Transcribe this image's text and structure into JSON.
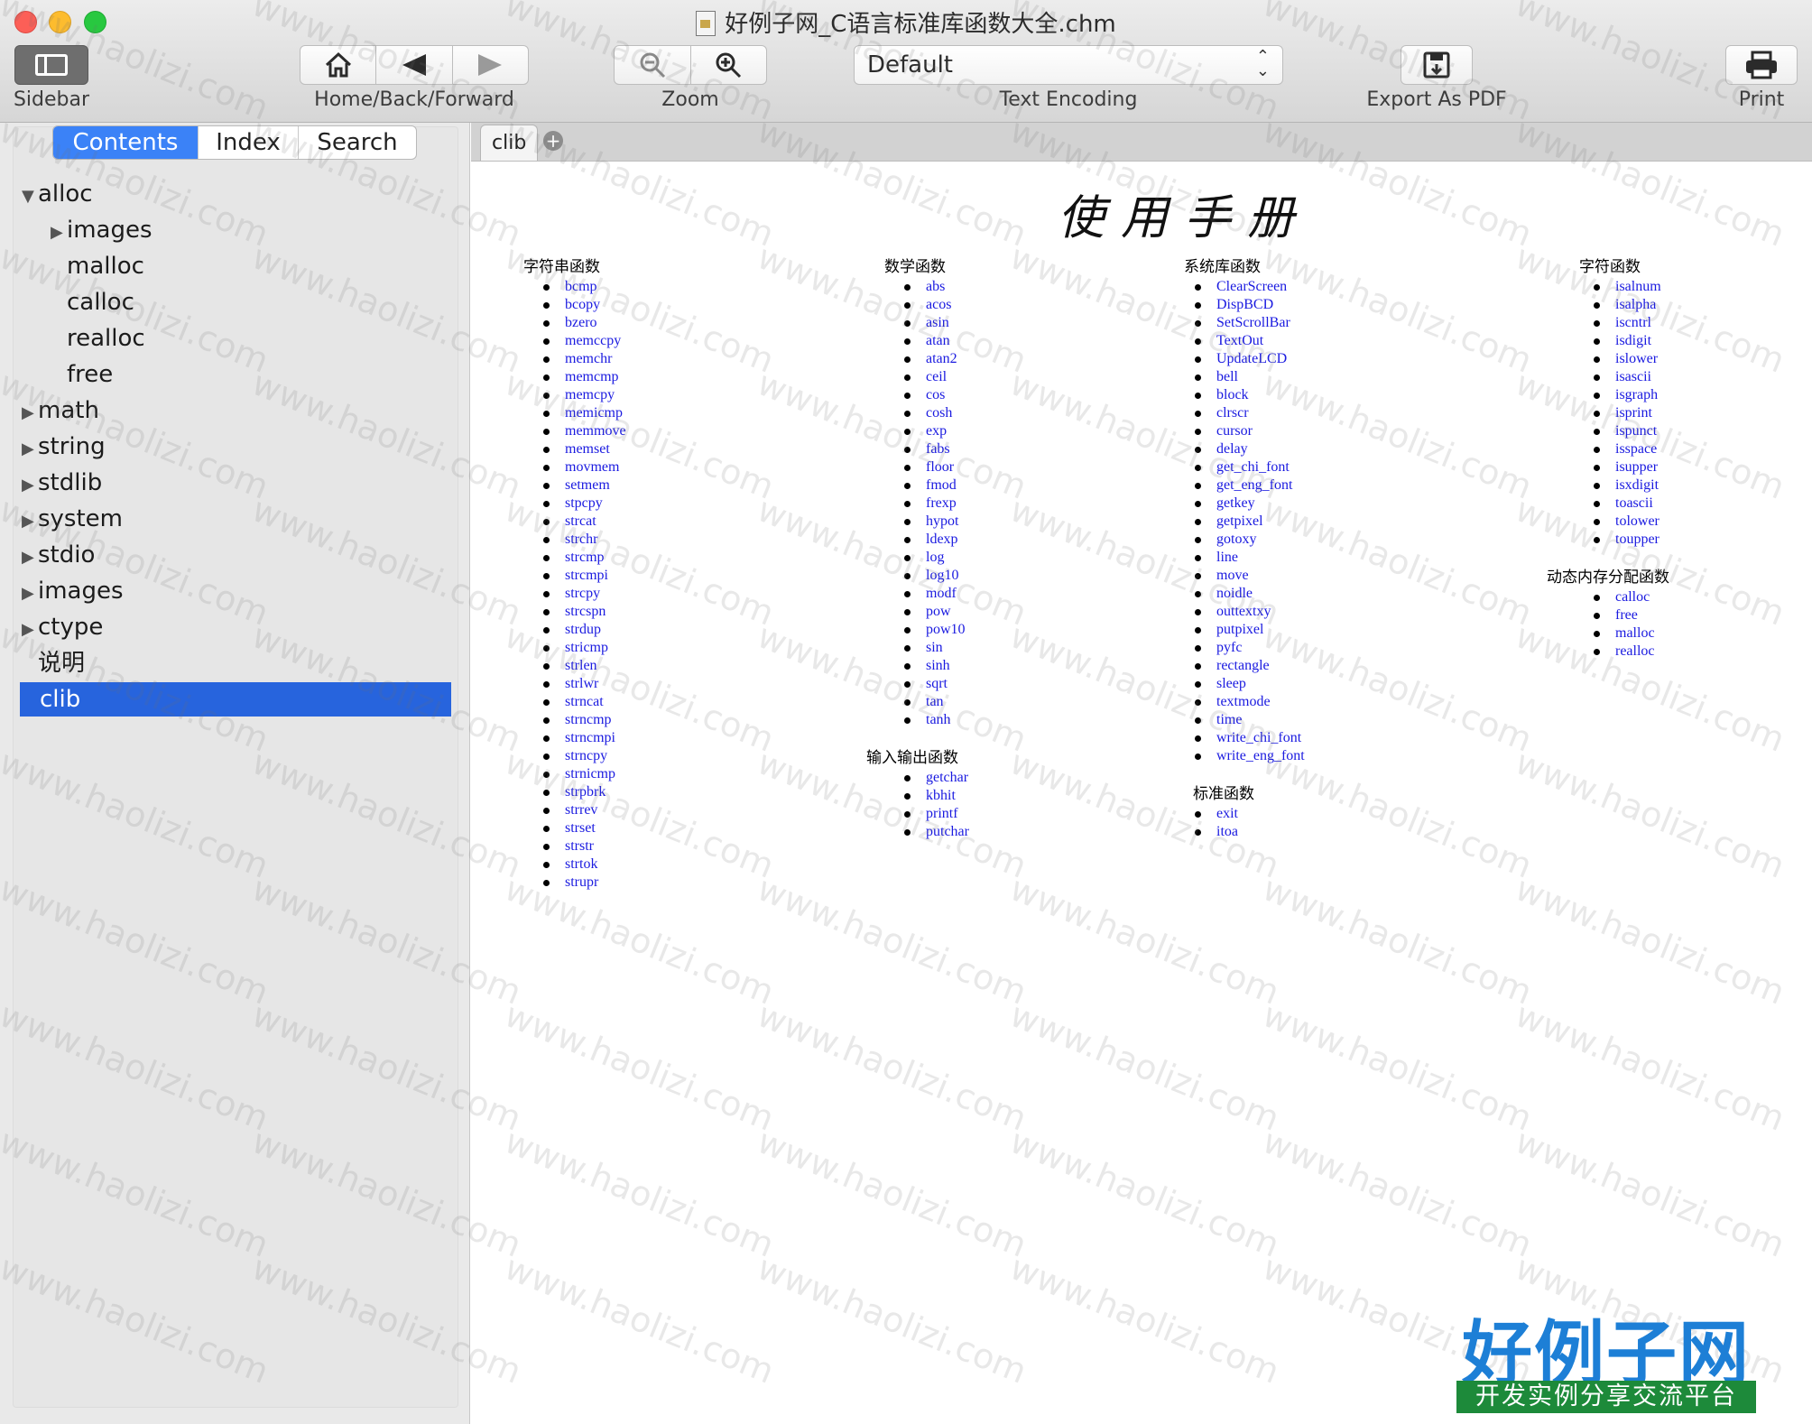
{
  "window": {
    "title": "好例子网_C语言标准库函数大全.chm"
  },
  "toolbar": {
    "sidebar_label": "Sidebar",
    "nav_label": "Home/Back/Forward",
    "zoom_label": "Zoom",
    "encoding_label": "Text Encoding",
    "encoding_value": "Default",
    "export_label": "Export As PDF",
    "print_label": "Print"
  },
  "sidebar": {
    "segments": [
      "Contents",
      "Index",
      "Search"
    ],
    "active_segment": "Contents",
    "tree": [
      {
        "label": "alloc",
        "expanded": true
      },
      {
        "label": "images",
        "child": true,
        "collapsed": true
      },
      {
        "label": "malloc",
        "child": true
      },
      {
        "label": "calloc",
        "child": true
      },
      {
        "label": "realloc",
        "child": true
      },
      {
        "label": "free",
        "child": true
      },
      {
        "label": "math",
        "collapsed": true
      },
      {
        "label": "string",
        "collapsed": true
      },
      {
        "label": "stdlib",
        "collapsed": true
      },
      {
        "label": "system",
        "collapsed": true
      },
      {
        "label": "stdio",
        "collapsed": true
      },
      {
        "label": "images",
        "collapsed": true
      },
      {
        "label": "ctype",
        "collapsed": true
      },
      {
        "label": "说明"
      },
      {
        "label": "clib",
        "selected": true
      }
    ]
  },
  "tabs": [
    {
      "label": "clib"
    }
  ],
  "content": {
    "title": "使用手册",
    "sections": {
      "string": {
        "heading": "字符串函数",
        "items": [
          "bcmp",
          "bcopy",
          "bzero",
          "memccpy",
          "memchr",
          "memcmp",
          "memcpy",
          "memicmp",
          "memmove",
          "memset",
          "movmem",
          "setmem",
          "stpcpy",
          "strcat",
          "strchr",
          "strcmp",
          "strcmpi",
          "strcpy",
          "strcspn",
          "strdup",
          "stricmp",
          "strlen",
          "strlwr",
          "strncat",
          "strncmp",
          "strncmpi",
          "strncpy",
          "strnicmp",
          "strpbrk",
          "strrev",
          "strset",
          "strstr",
          "strtok",
          "strupr"
        ]
      },
      "math": {
        "heading": "数学函数",
        "items": [
          "abs",
          "acos",
          "asin",
          "atan",
          "atan2",
          "ceil",
          "cos",
          "cosh",
          "exp",
          "fabs",
          "floor",
          "fmod",
          "frexp",
          "hypot",
          "ldexp",
          "log",
          "log10",
          "modf",
          "pow",
          "pow10",
          "sin",
          "sinh",
          "sqrt",
          "tan",
          "tanh"
        ]
      },
      "io": {
        "heading": "输入输出函数",
        "items": [
          "getchar",
          "kbhit",
          "printf",
          "putchar"
        ]
      },
      "system": {
        "heading": "系统库函数",
        "items": [
          "ClearScreen",
          "DispBCD",
          "SetScrollBar",
          "TextOut",
          "UpdateLCD",
          "bell",
          "block",
          "clrscr",
          "cursor",
          "delay",
          "get_chi_font",
          "get_eng_font",
          "getkey",
          "getpixel",
          "gotoxy",
          "line",
          "move",
          "noidle",
          "outtextxy",
          "putpixel",
          "pyfc",
          "rectangle",
          "sleep",
          "textmode",
          "time",
          "write_chi_font",
          "write_eng_font"
        ]
      },
      "standard": {
        "heading": "标准函数",
        "items": [
          "exit",
          "itoa"
        ]
      },
      "ctype": {
        "heading": "字符函数",
        "items": [
          "isalnum",
          "isalpha",
          "iscntrl",
          "isdigit",
          "islower",
          "isascii",
          "isgraph",
          "isprint",
          "ispunct",
          "isspace",
          "isupper",
          "isxdigit",
          "toascii",
          "tolower",
          "toupper"
        ]
      },
      "alloc": {
        "heading": "动态内存分配函数",
        "items": [
          "calloc",
          "free",
          "malloc",
          "realloc"
        ]
      }
    }
  },
  "watermark": {
    "text": "www.haolizi.com",
    "logo_main": "好例子网",
    "logo_sub": "开发实例分享交流平台"
  }
}
